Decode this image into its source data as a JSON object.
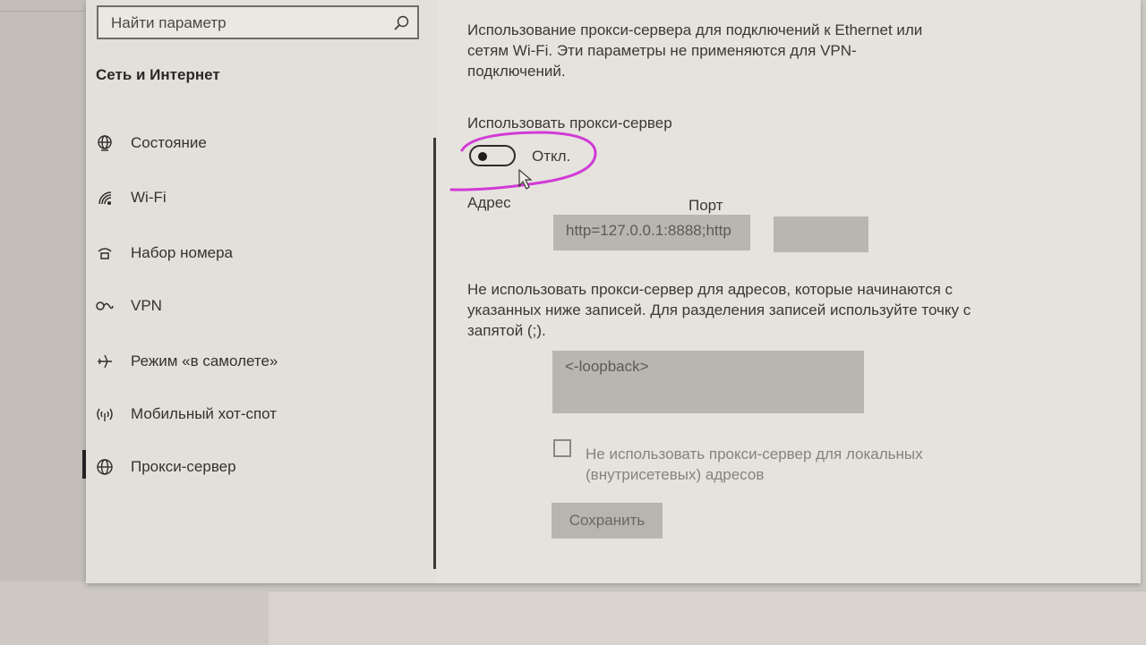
{
  "search": {
    "placeholder": "Найти параметр",
    "icon": "search-icon"
  },
  "sidebar": {
    "section_title": "Сеть и Интернет",
    "items": [
      {
        "label": "Состояние",
        "icon": "globe-status-icon"
      },
      {
        "label": "Wi-Fi",
        "icon": "wifi-icon"
      },
      {
        "label": "Набор номера",
        "icon": "dialup-icon"
      },
      {
        "label": "VPN",
        "icon": "vpn-icon"
      },
      {
        "label": "Режим «в самолете»",
        "icon": "airplane-icon"
      },
      {
        "label": "Мобильный хот-спот",
        "icon": "hotspot-icon"
      },
      {
        "label": "Прокси-сервер",
        "icon": "globe-icon",
        "active": true
      }
    ]
  },
  "main": {
    "description": "Использование прокси-сервера для подключений к Ethernet или сетям Wi-Fi. Эти параметры не применяются для VPN-подключений.",
    "use_proxy_label": "Использовать прокси-сервер",
    "toggle_state": "Откл.",
    "toggle_on": false,
    "address_label": "Адрес",
    "address_value": "http=127.0.0.1:8888;http",
    "port_label": "Порт",
    "port_value": "",
    "exceptions_text": "Не использовать прокси-сервер для адресов, которые начинаются с указанных ниже записей. Для разделения записей используйте точку с запятой (;).",
    "exceptions_value": "<-loopback>",
    "local_checkbox_label": "Не использовать прокси-сервер для локальных (внутрисетевых) адресов",
    "local_checkbox_checked": false,
    "save_label": "Сохранить"
  },
  "colors": {
    "annotation": "#d13ad6",
    "field_disabled": "#b9b5af"
  }
}
